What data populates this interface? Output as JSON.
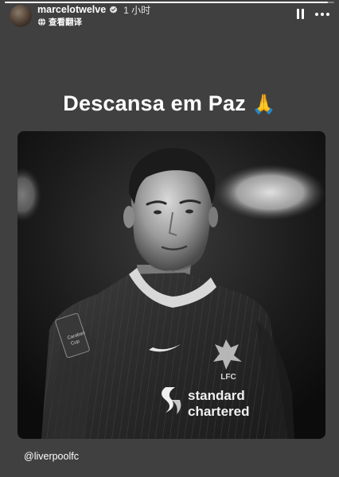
{
  "story": {
    "progress": 0.98
  },
  "header": {
    "username": "marcelotwelve",
    "time_ago": "1 小时",
    "translate_label": "查看翻译",
    "icons": {
      "verified": "verified-badge-icon",
      "globe": "globe-icon",
      "pause": "pause-icon",
      "more": "more-icon"
    }
  },
  "caption": {
    "text": "Descansa em Paz",
    "emoji": "🙏"
  },
  "photo": {
    "sponsor_line1": "standard",
    "sponsor_line2": "chartered",
    "club_text": "LFC",
    "sleeve_text_1": "Carabao",
    "sleeve_text_2": "Cup"
  },
  "mention": {
    "text": "@liverpoolfc"
  }
}
